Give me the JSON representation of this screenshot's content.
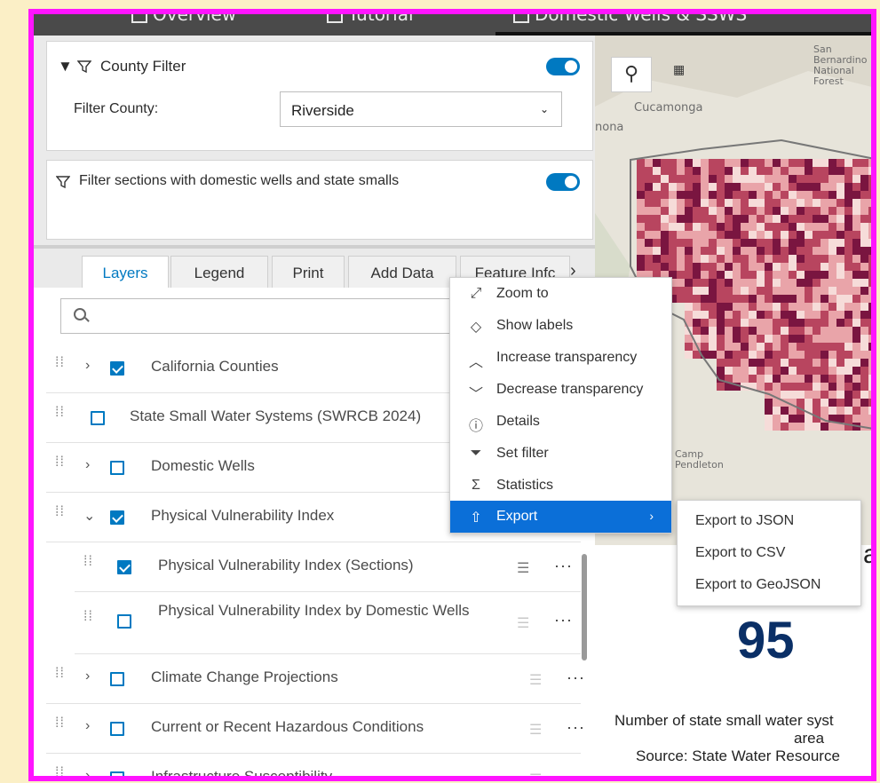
{
  "topnav": {
    "items": [
      "Overview",
      "Tutorial",
      "Domestic Wells & SSWS"
    ]
  },
  "county_filter": {
    "title": "County Filter",
    "field_label": "Filter County:",
    "selected": "Riverside",
    "enabled": true
  },
  "section_filter": {
    "title": "Filter sections with domestic wells and state smalls",
    "enabled": true
  },
  "tabs": [
    "Layers",
    "Legend",
    "Print",
    "Add Data",
    "Feature Info"
  ],
  "tabs_visible": [
    "Layers",
    "Legend",
    "Print",
    "Add Data",
    "Feature Infc"
  ],
  "active_tab": "Layers",
  "search": {
    "placeholder": ""
  },
  "layers": [
    {
      "label": "California Counties",
      "checked": true,
      "expandable": true
    },
    {
      "label": "State Small Water Systems (SWRCB 2024)",
      "checked": false,
      "expandable": false
    },
    {
      "label": "Domestic Wells",
      "checked": false,
      "expandable": true
    },
    {
      "label": "Physical Vulnerability Index",
      "checked": true,
      "expanded": true
    },
    {
      "label": "Physical Vulnerability Index (Sections)",
      "checked": true
    },
    {
      "label": "Physical Vulnerability Index by Domestic Wells",
      "checked": false
    },
    {
      "label": "Climate Change Projections",
      "checked": false,
      "expandable": true
    },
    {
      "label": "Current or Recent Hazardous Conditions",
      "checked": false,
      "expandable": true
    },
    {
      "label": "Infrastructure Susceptibility",
      "checked": false,
      "expandable": true
    }
  ],
  "context_menu": {
    "items": [
      {
        "icon": "zoom-to-icon",
        "label": "Zoom to"
      },
      {
        "icon": "tag-icon",
        "label": "Show labels"
      },
      {
        "icon": "chevron-up-icon",
        "label": "Increase transparency"
      },
      {
        "icon": "chevron-down-icon",
        "label": "Decrease transparency"
      },
      {
        "icon": "info-icon",
        "label": "Details"
      },
      {
        "icon": "filter-icon",
        "label": "Set filter"
      },
      {
        "icon": "sigma-icon",
        "label": "Statistics"
      },
      {
        "icon": "export-icon",
        "label": "Export"
      }
    ],
    "selected": "Export"
  },
  "export_submenu": [
    "Export to JSON",
    "Export to CSV",
    "Export to GeoJSON"
  ],
  "map": {
    "place_labels": [
      "San Bernardino National Forest",
      "Cucamonga",
      "nona",
      "Camp Pendleton"
    ],
    "colors": {
      "dark": "#7a1540",
      "mid": "#b8455f",
      "light": "#e9a4a9",
      "pale": "#f6dcd9"
    }
  },
  "statistic": {
    "value": "95",
    "caption_line1": "Number of state small water syst",
    "caption_line2": "area",
    "source": "Source: State Water Resource"
  },
  "accent": "#0079c1"
}
